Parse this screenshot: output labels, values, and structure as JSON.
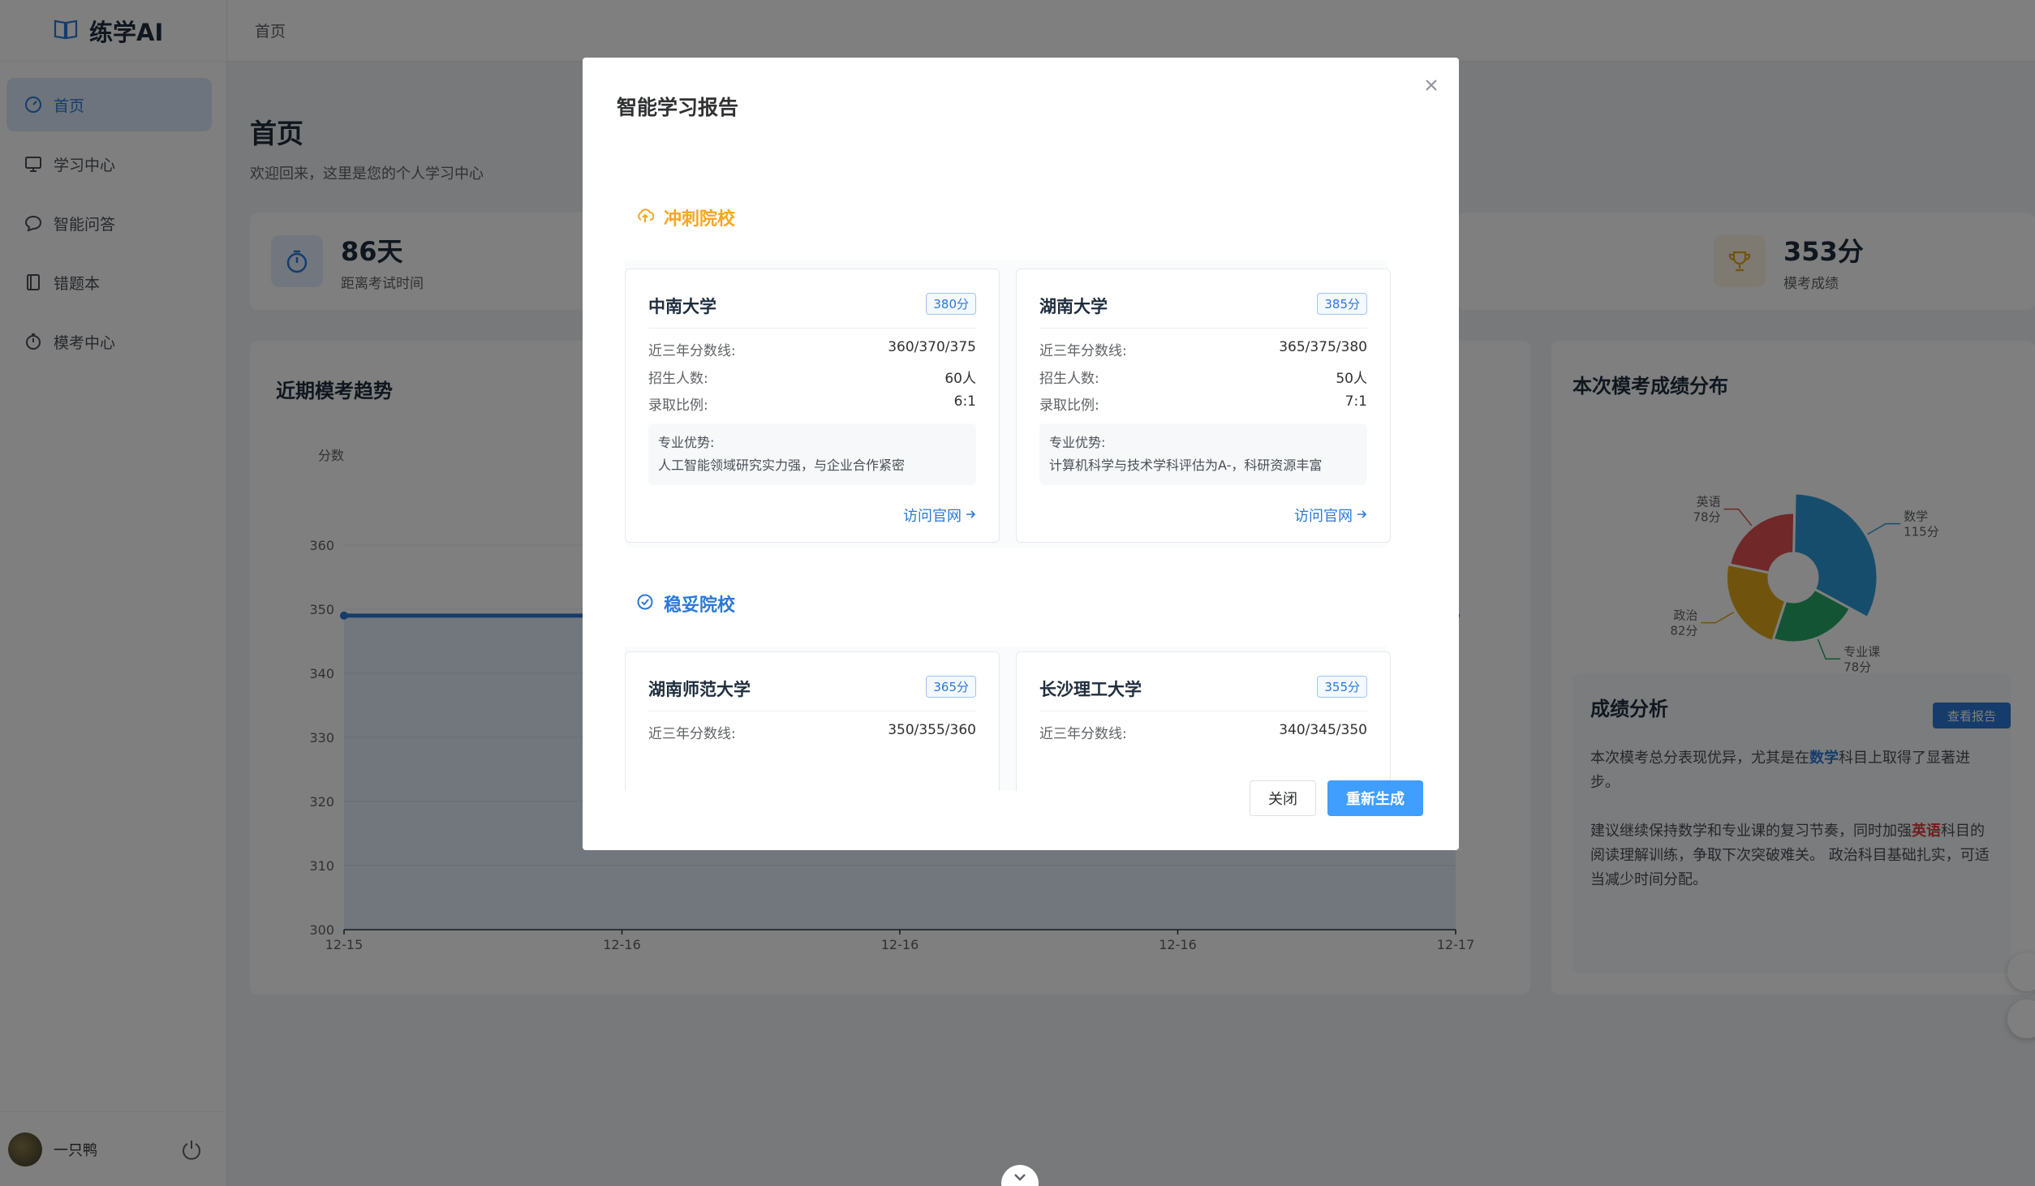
{
  "app": {
    "name": "练学AI"
  },
  "sidebar": {
    "items": [
      {
        "label": "首页",
        "icon": "dashboard-icon",
        "active": true
      },
      {
        "label": "学习中心",
        "icon": "monitor-icon",
        "active": false
      },
      {
        "label": "智能问答",
        "icon": "chat-icon",
        "active": false
      },
      {
        "label": "错题本",
        "icon": "notebook-icon",
        "active": false
      },
      {
        "label": "模考中心",
        "icon": "stopwatch-icon",
        "active": false
      }
    ],
    "user": {
      "name": "一只鸭"
    }
  },
  "header": {
    "breadcrumb": "首页"
  },
  "main": {
    "title": "首页",
    "subtitle": "欢迎回来，这里是您的个人学习中心",
    "stats": [
      {
        "value": "86天",
        "label": "距离考试时间",
        "icon": "stopwatch-icon"
      },
      {
        "value": "353分",
        "label": "模考成绩",
        "icon": "trophy-icon"
      }
    ],
    "trend": {
      "title": "近期模考趋势",
      "ylabel": "分数",
      "ylim": [
        300,
        360
      ],
      "yticks": [
        "360",
        "350",
        "340",
        "330",
        "320",
        "310",
        "300"
      ],
      "xticks": [
        "12-15",
        "12-16",
        "12-16",
        "12-16",
        "12-17"
      ]
    },
    "distribution": {
      "title": "本次模考成绩分布",
      "legend": [
        "数学",
        "专业课",
        "政治",
        "英语"
      ],
      "labels": [
        {
          "name": "数学",
          "score": "115分"
        },
        {
          "name": "专业课",
          "score": "78分"
        },
        {
          "name": "政治",
          "score": "82分"
        },
        {
          "name": "英语",
          "score": "78分"
        }
      ]
    },
    "analysis": {
      "title": "成绩分析",
      "button": "查看报告",
      "p1_a": "本次模考总分表现优异，尤其是在",
      "p1_hl": "数学",
      "p1_b": "科目上取得了显著进步。",
      "p2_a": "建议继续保持数学和专业课的复习节奏，同时加强",
      "p2_hl": "英语",
      "p2_b": "科目的阅读理解训练，争取下次突破难关。 政治科目基础扎实，可适当减少时间分配。"
    }
  },
  "chart_data": [
    {
      "type": "area",
      "title": "近期模考趋势",
      "ylabel": "分数",
      "ylim": [
        300,
        360
      ],
      "x": [
        "12-15",
        "12-16",
        "12-16",
        "12-16",
        "12-17"
      ],
      "values": [
        349,
        349,
        349,
        349,
        349
      ]
    },
    {
      "type": "pie",
      "title": "本次模考成绩分布",
      "categories": [
        "数学",
        "专业课",
        "政治",
        "英语"
      ],
      "values": [
        115,
        78,
        82,
        78
      ],
      "colors": [
        "#2f9bd8",
        "#27a86a",
        "#e0a81c",
        "#e05050"
      ],
      "legend": "bottom"
    }
  ],
  "modal": {
    "title": "智能学习报告",
    "close_label": "关闭",
    "regen_label": "重新生成",
    "sections": [
      {
        "name": "冲刺院校",
        "color": "#f5a623",
        "icon": "upload-cloud-icon",
        "schools": [
          {
            "name": "中南大学",
            "tag": "380分",
            "lines_label": "近三年分数线:",
            "lines": "360/370/375",
            "enroll_label": "招生人数:",
            "enroll": "60人",
            "ratio_label": "录取比例:",
            "ratio": "6:1",
            "adv_label": "专业优势:",
            "adv": "人工智能领域研究实力强，与企业合作紧密",
            "visit": "访问官网"
          },
          {
            "name": "湖南大学",
            "tag": "385分",
            "lines_label": "近三年分数线:",
            "lines": "365/375/380",
            "enroll_label": "招生人数:",
            "enroll": "50人",
            "ratio_label": "录取比例:",
            "ratio": "7:1",
            "adv_label": "专业优势:",
            "adv": "计算机科学与技术学科评估为A-，科研资源丰富",
            "visit": "访问官网"
          }
        ]
      },
      {
        "name": "稳妥院校",
        "color": "#2b78d6",
        "icon": "check-circle-icon",
        "schools": [
          {
            "name": "湖南师范大学",
            "tag": "365分",
            "lines_label": "近三年分数线:",
            "lines": "350/355/360"
          },
          {
            "name": "长沙理工大学",
            "tag": "355分",
            "lines_label": "近三年分数线:",
            "lines": "340/345/350"
          }
        ]
      }
    ]
  }
}
